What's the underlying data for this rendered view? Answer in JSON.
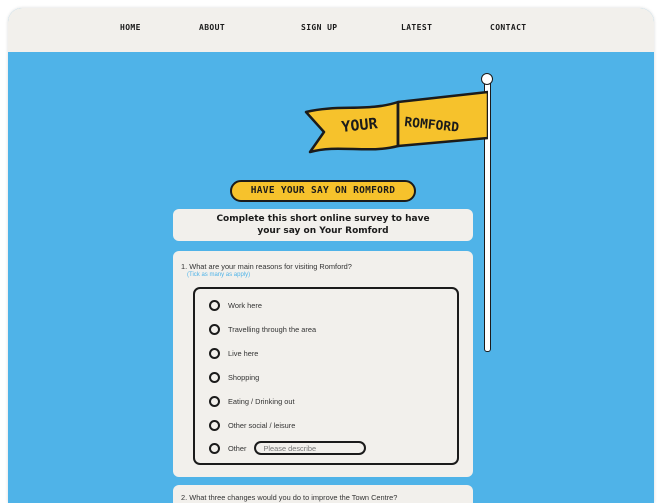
{
  "nav": {
    "items": [
      {
        "label": "HOME"
      },
      {
        "label": "ABOUT"
      },
      {
        "label": "SIGN UP"
      },
      {
        "label": "LATEST"
      },
      {
        "label": "CONTACT"
      }
    ]
  },
  "flag": {
    "line1": "YOUR",
    "line2": "ROMFORD"
  },
  "headline": "HAVE YOUR SAY ON ROMFORD",
  "intro": {
    "line1": "Complete this short online survey to have",
    "line2": "your say on Your Romford"
  },
  "question1": {
    "title": "1. What are your main reasons for visiting Romford?",
    "hint": "(Tick as many as apply)",
    "options": [
      {
        "label": "Work here"
      },
      {
        "label": "Travelling through the area"
      },
      {
        "label": "Live here"
      },
      {
        "label": "Shopping"
      },
      {
        "label": "Eating / Drinking out"
      },
      {
        "label": "Other social / leisure"
      },
      {
        "label": "Other"
      }
    ],
    "describe_placeholder": "Please describe"
  },
  "question2": {
    "title": "2. What three changes would you do to improve the Town Centre?"
  },
  "colors": {
    "background": "#4fb3e8",
    "card": "#f2f0ec",
    "accent_yellow": "#f6c22c",
    "ink": "#1b1b1b"
  }
}
